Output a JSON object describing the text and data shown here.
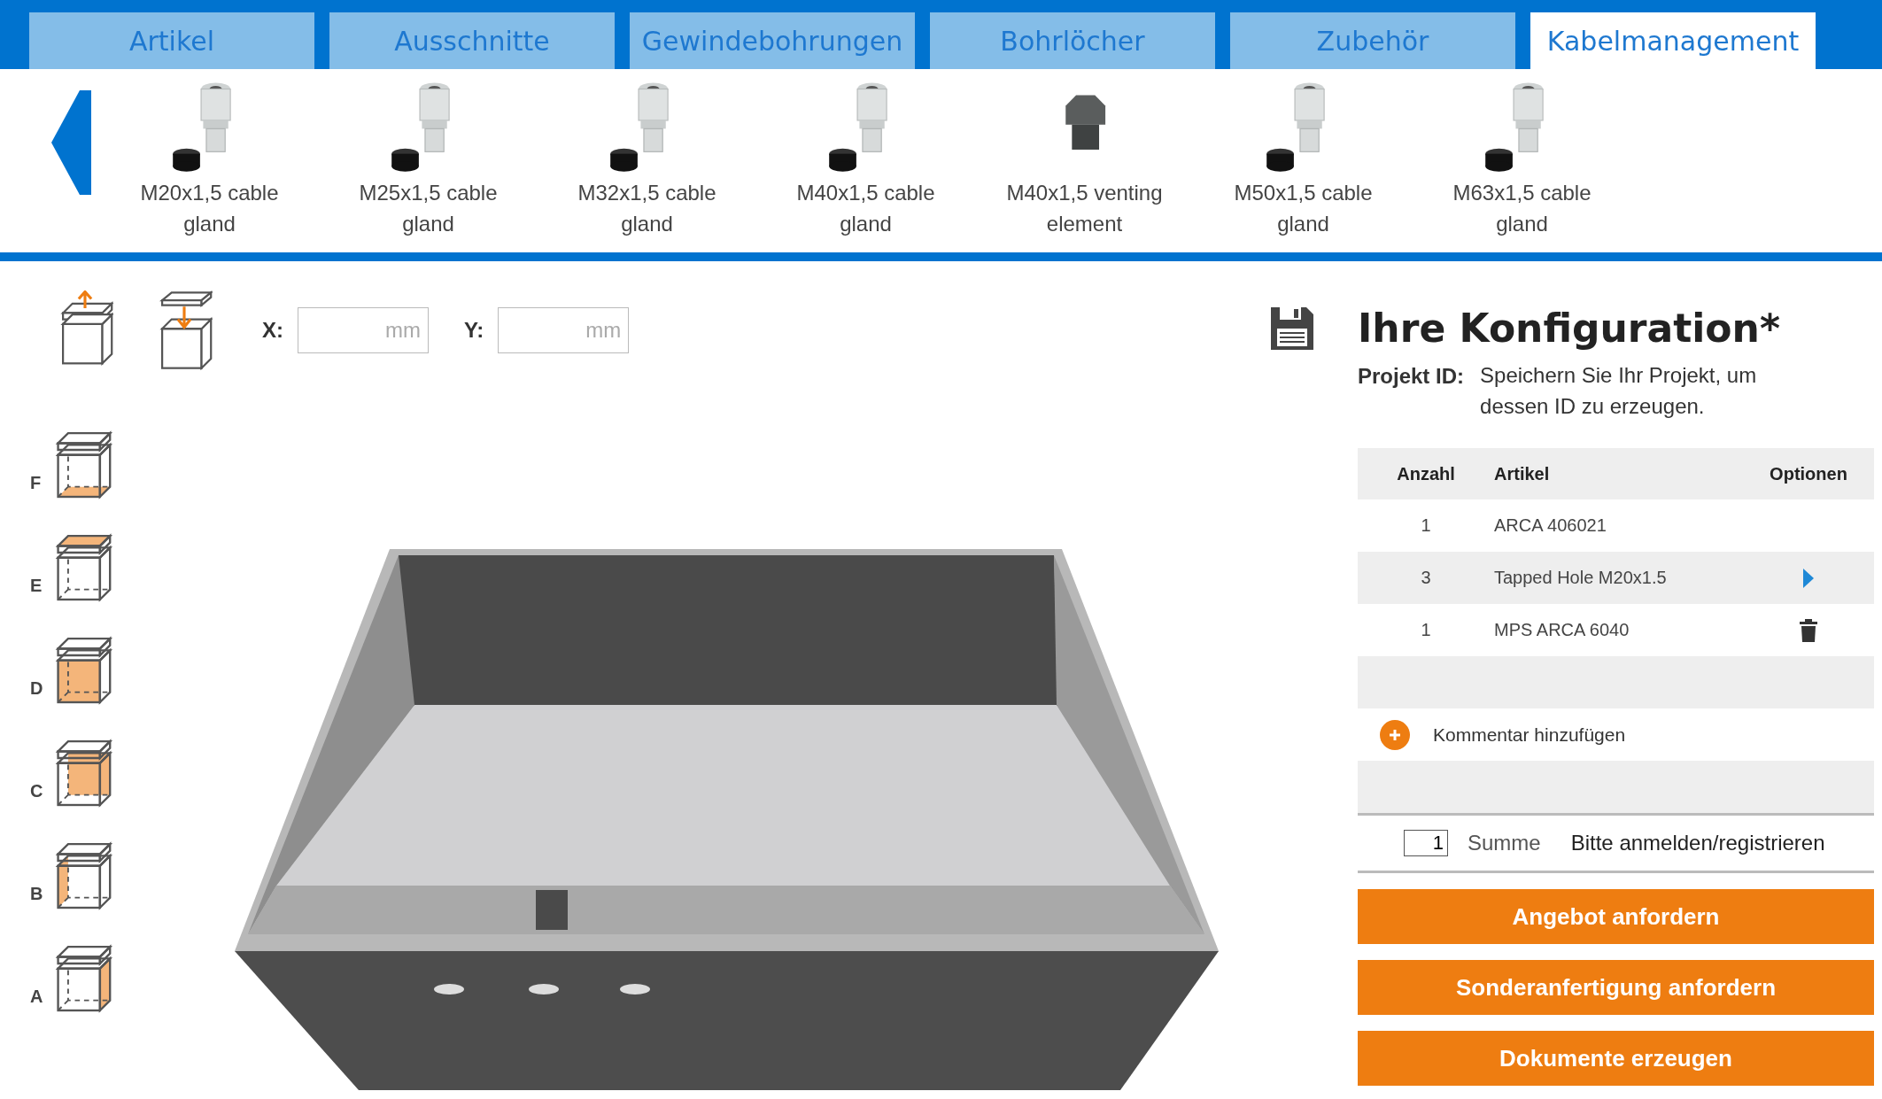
{
  "tabs": [
    {
      "label": "Artikel",
      "selected": false
    },
    {
      "label": "Ausschnitte",
      "selected": false
    },
    {
      "label": "Gewindebohrungen",
      "selected": false
    },
    {
      "label": "Bohrlöcher",
      "selected": false
    },
    {
      "label": "Zubehör",
      "selected": false
    },
    {
      "label": "Kabelmanagement",
      "selected": true
    }
  ],
  "products": [
    {
      "label": "M20x1,5 cable gland",
      "kind": "gland"
    },
    {
      "label": "M25x1,5 cable gland",
      "kind": "gland"
    },
    {
      "label": "M32x1,5 cable gland",
      "kind": "gland"
    },
    {
      "label": "M40x1,5 cable gland",
      "kind": "gland"
    },
    {
      "label": "M40x1,5 venting element",
      "kind": "vent"
    },
    {
      "label": "M50x1,5 cable gland",
      "kind": "gland"
    },
    {
      "label": "M63x1,5 cable gland",
      "kind": "gland"
    }
  ],
  "position_fields": [
    {
      "label": "X:",
      "placeholder": "mm"
    },
    {
      "label": "Y:",
      "placeholder": "mm"
    }
  ],
  "views": [
    {
      "label": "F",
      "kind": "bottom"
    },
    {
      "label": "E",
      "kind": "top"
    },
    {
      "label": "D",
      "kind": "front"
    },
    {
      "label": "C",
      "kind": "back"
    },
    {
      "label": "B",
      "kind": "left"
    },
    {
      "label": "A",
      "kind": "right"
    }
  ],
  "configuration": {
    "title": "Ihre Konfiguration*",
    "project_id_label": "Projekt ID:",
    "project_id_text": "Speichern Sie Ihr Projekt, um dessen ID zu erzeugen.",
    "columns": [
      "Anzahl",
      "Artikel",
      "Optionen"
    ],
    "rows": [
      {
        "quantity": "1",
        "article": "ARCA 406021",
        "kind": "plain"
      },
      {
        "quantity": "3",
        "article": "Tapped Hole M20x1.5",
        "kind": "expand"
      },
      {
        "quantity": "1",
        "article": "MPS ARCA 6040",
        "kind": "delete"
      }
    ],
    "comment": "Kommentar hinzufügen",
    "summary": {
      "quantity": "1",
      "label": "Summe",
      "value": "Bitte anmelden/registrieren"
    },
    "buttons": [
      "Angebot anfordern",
      "Sonderanfertigung anfordern",
      "Dokumente erzeugen"
    ]
  }
}
